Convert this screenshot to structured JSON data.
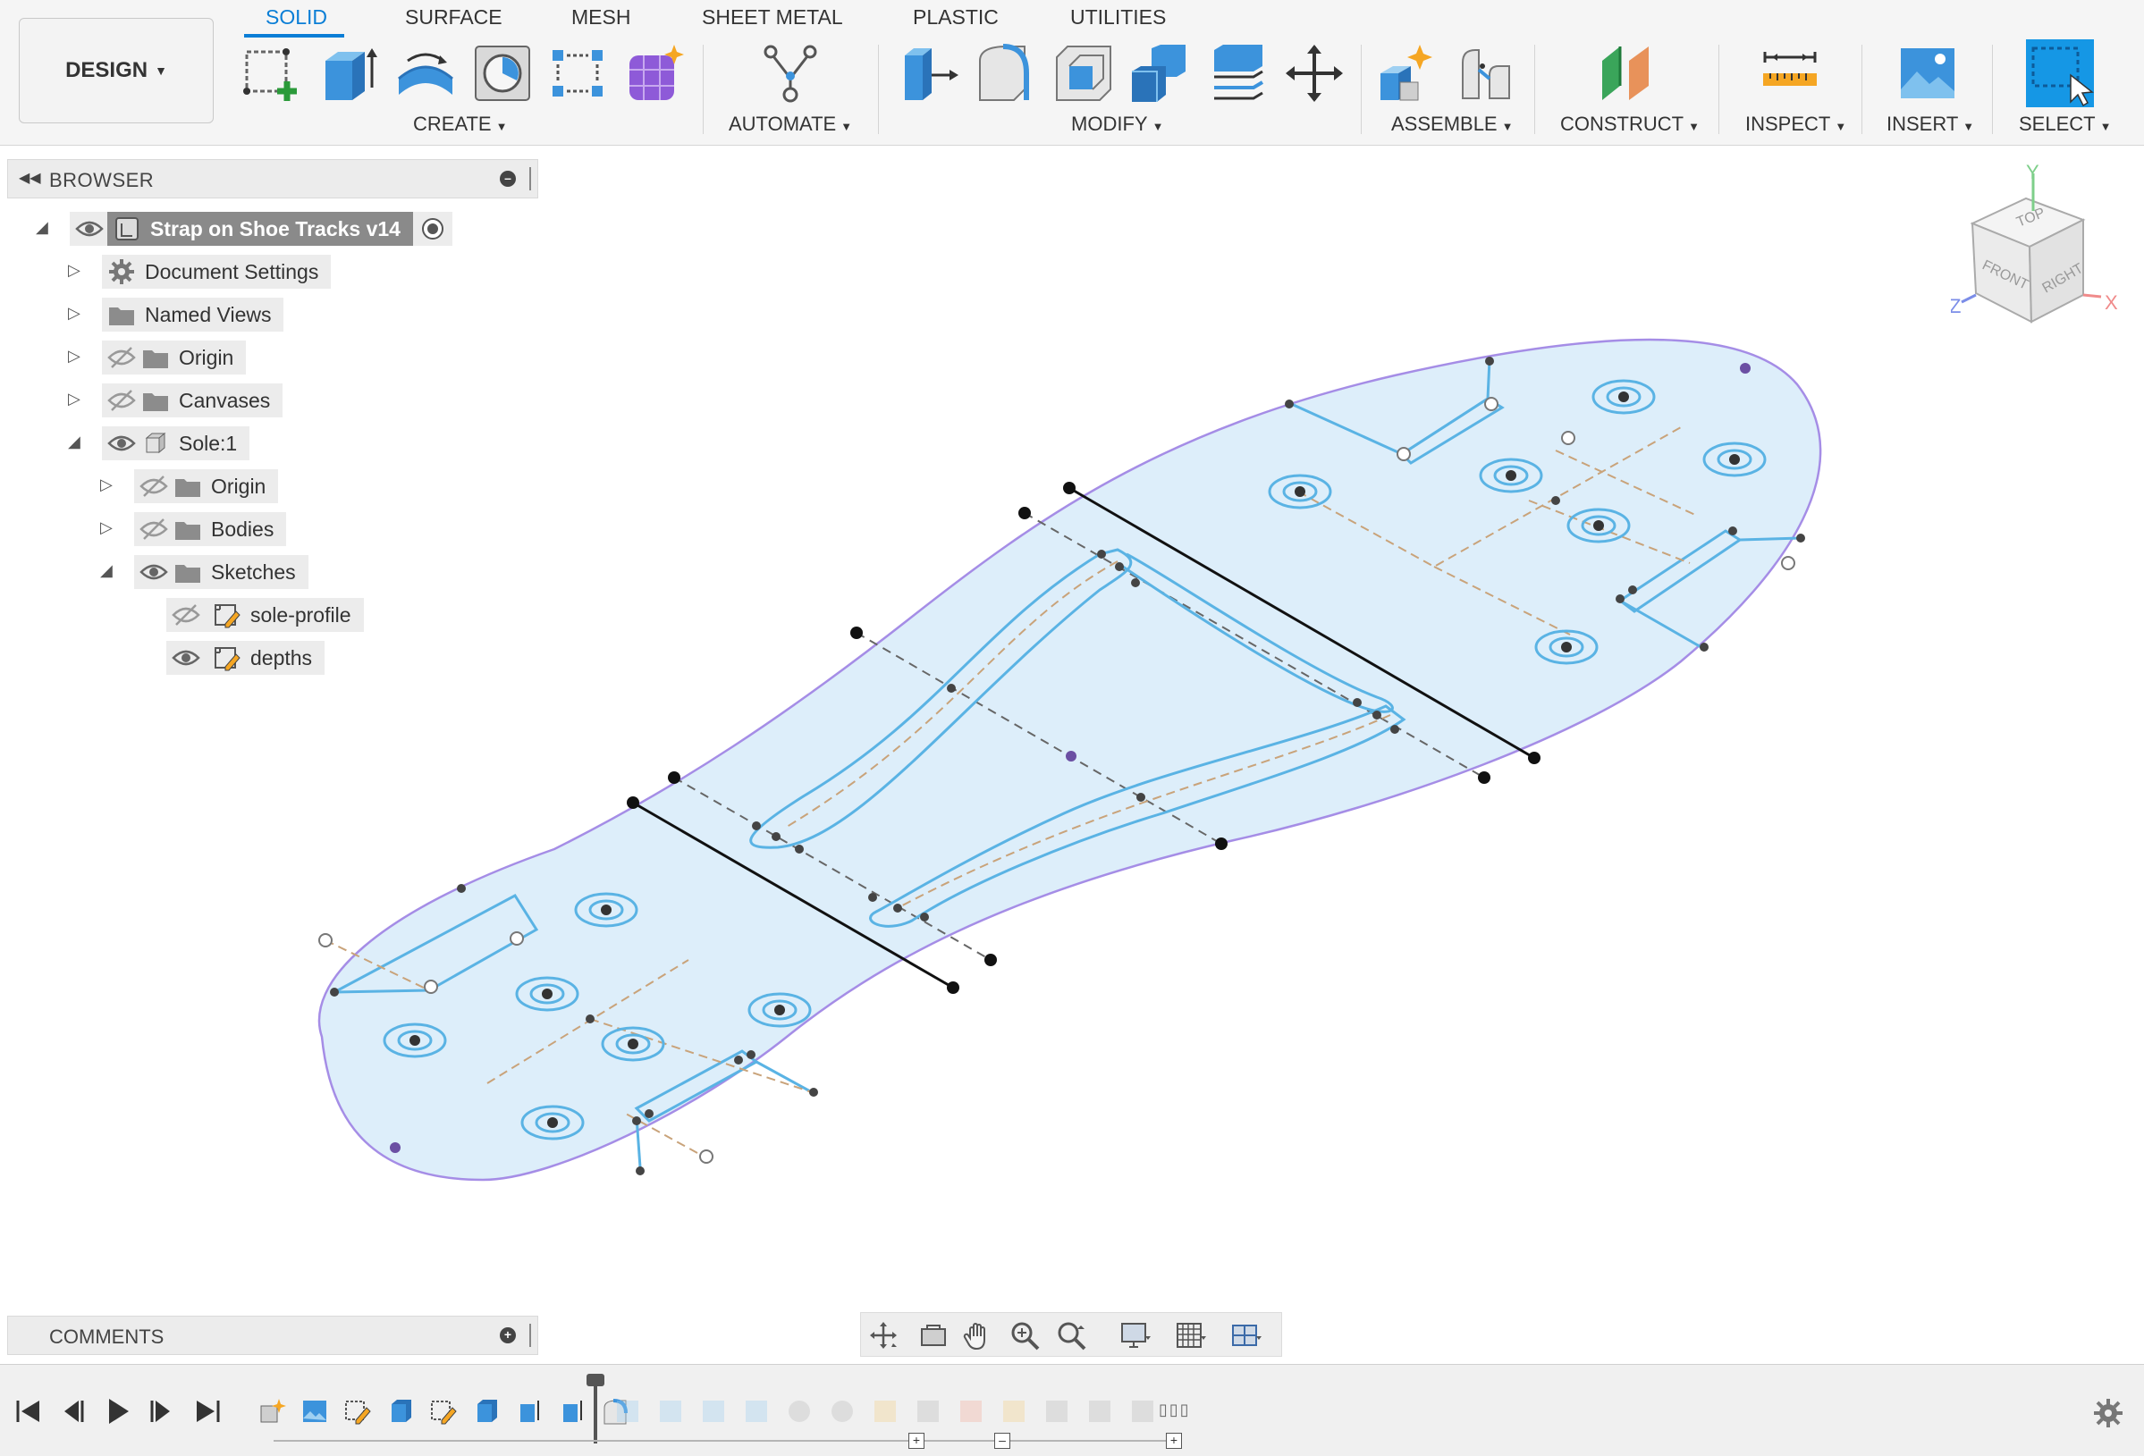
{
  "workspace": {
    "label": "DESIGN"
  },
  "tabs": [
    {
      "label": "SOLID",
      "active": true
    },
    {
      "label": "SURFACE",
      "active": false
    },
    {
      "label": "MESH",
      "active": false
    },
    {
      "label": "SHEET METAL",
      "active": false
    },
    {
      "label": "PLASTIC",
      "active": false
    },
    {
      "label": "UTILITIES",
      "active": false
    }
  ],
  "groups": {
    "create": "CREATE",
    "automate": "AUTOMATE",
    "modify": "MODIFY",
    "assemble": "ASSEMBLE",
    "construct": "CONSTRUCT",
    "inspect": "INSPECT",
    "insert": "INSERT",
    "select": "SELECT"
  },
  "browser": {
    "title": "BROWSER",
    "items": [
      {
        "label": "Strap on Shoe Tracks v14",
        "icon": "component-icon",
        "expanded": true,
        "visible": true,
        "selected": true
      },
      {
        "label": "Document Settings",
        "icon": "gear-icon",
        "expanded": false
      },
      {
        "label": "Named Views",
        "icon": "folder-icon",
        "expanded": false
      },
      {
        "label": "Origin",
        "icon": "folder-icon",
        "expanded": false,
        "visible": false
      },
      {
        "label": "Canvases",
        "icon": "folder-icon",
        "expanded": false,
        "visible": false
      },
      {
        "label": "Sole:1",
        "icon": "body-icon",
        "expanded": true,
        "visible": true
      },
      {
        "label": "Origin",
        "icon": "folder-icon",
        "expanded": false,
        "visible": false
      },
      {
        "label": "Bodies",
        "icon": "folder-icon",
        "expanded": false,
        "visible": false
      },
      {
        "label": "Sketches",
        "icon": "folder-icon",
        "expanded": true,
        "visible": true
      },
      {
        "label": "sole-profile",
        "icon": "sketch-icon",
        "visible": false
      },
      {
        "label": "depths",
        "icon": "sketch-icon",
        "visible": true
      }
    ]
  },
  "comments": {
    "title": "COMMENTS"
  },
  "viewcube": {
    "top": "TOP",
    "front": "FRONT",
    "right": "RIGHT",
    "axis_x": "X",
    "axis_y": "Y",
    "axis_z": "Z"
  },
  "colors": {
    "accent": "#0a7ed6",
    "sole_fill": "#ddeefa",
    "sole_outline": "#a58de6",
    "sketch_line": "#5ab3e4",
    "construction_line": "#c9a37a"
  }
}
